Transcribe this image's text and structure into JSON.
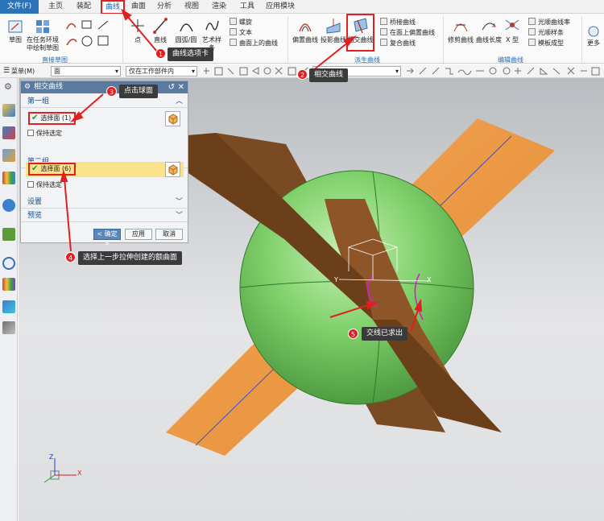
{
  "menu": {
    "file": "文件(F)",
    "tabs": [
      "主页",
      "装配",
      "曲线",
      "曲面",
      "分析",
      "视图",
      "渲染",
      "工具",
      "应用模块"
    ],
    "active_tab": "曲线"
  },
  "ribbon": {
    "sketch_group": {
      "sketch": "草图",
      "in_task": "在任务环境",
      "in_task2": "中绘制草图",
      "label": "直接草图"
    },
    "point": "点",
    "line": "直线",
    "arc": "圆弧/圆",
    "spline": "艺术样条",
    "helix": "螺旋",
    "text": "文本",
    "curve_on_face": "曲面上的曲线",
    "offset_curve": "偏置曲线",
    "project_curve": "投影曲线",
    "intersect_curve": "相交曲线",
    "bridge_curve": "桥接曲线",
    "offset_on_face": "在面上偏置曲线",
    "composite_curve": "复合曲线",
    "derived_label": "派生曲线",
    "trim_curve": "修剪曲线",
    "curve_length": "曲线长度",
    "x_form": "X 型",
    "smooth_rate": "光顺曲线率",
    "smooth_spline": "光顺样条",
    "template_form": "模板成型",
    "edit_label": "编辑曲线",
    "more": "更多"
  },
  "quickbar": {
    "menu": "菜单(M)",
    "filter": "面",
    "scope": "仅在工作部件内"
  },
  "dialog": {
    "title": "相交曲线",
    "group1": "第一组",
    "select1": "选择面 (1)",
    "keep1": "保持选定",
    "group2": "第二组",
    "select2": "选择面 (6)",
    "keep2": "保持选定",
    "settings": "设置",
    "preview": "预览",
    "ok": "< 确定 >",
    "apply": "应用",
    "cancel": "取消"
  },
  "axes": {
    "y": "Y",
    "x": "X",
    "z": "Z"
  },
  "callouts": {
    "c1": {
      "num": "1",
      "text": "曲线选项卡"
    },
    "c2": {
      "num": "2",
      "text": "相交曲线"
    },
    "c3": {
      "num": "3",
      "text": "点击球面"
    },
    "c4": {
      "num": "4",
      "text": "选择上一步拉伸创建的额曲面"
    },
    "c5": {
      "num": "5",
      "text": "交线已求出"
    }
  },
  "colors": {
    "accent": "#2a73b8",
    "callout_red": "#e02020",
    "sphere": "#7dcf68",
    "surface": "#ec9a45"
  }
}
